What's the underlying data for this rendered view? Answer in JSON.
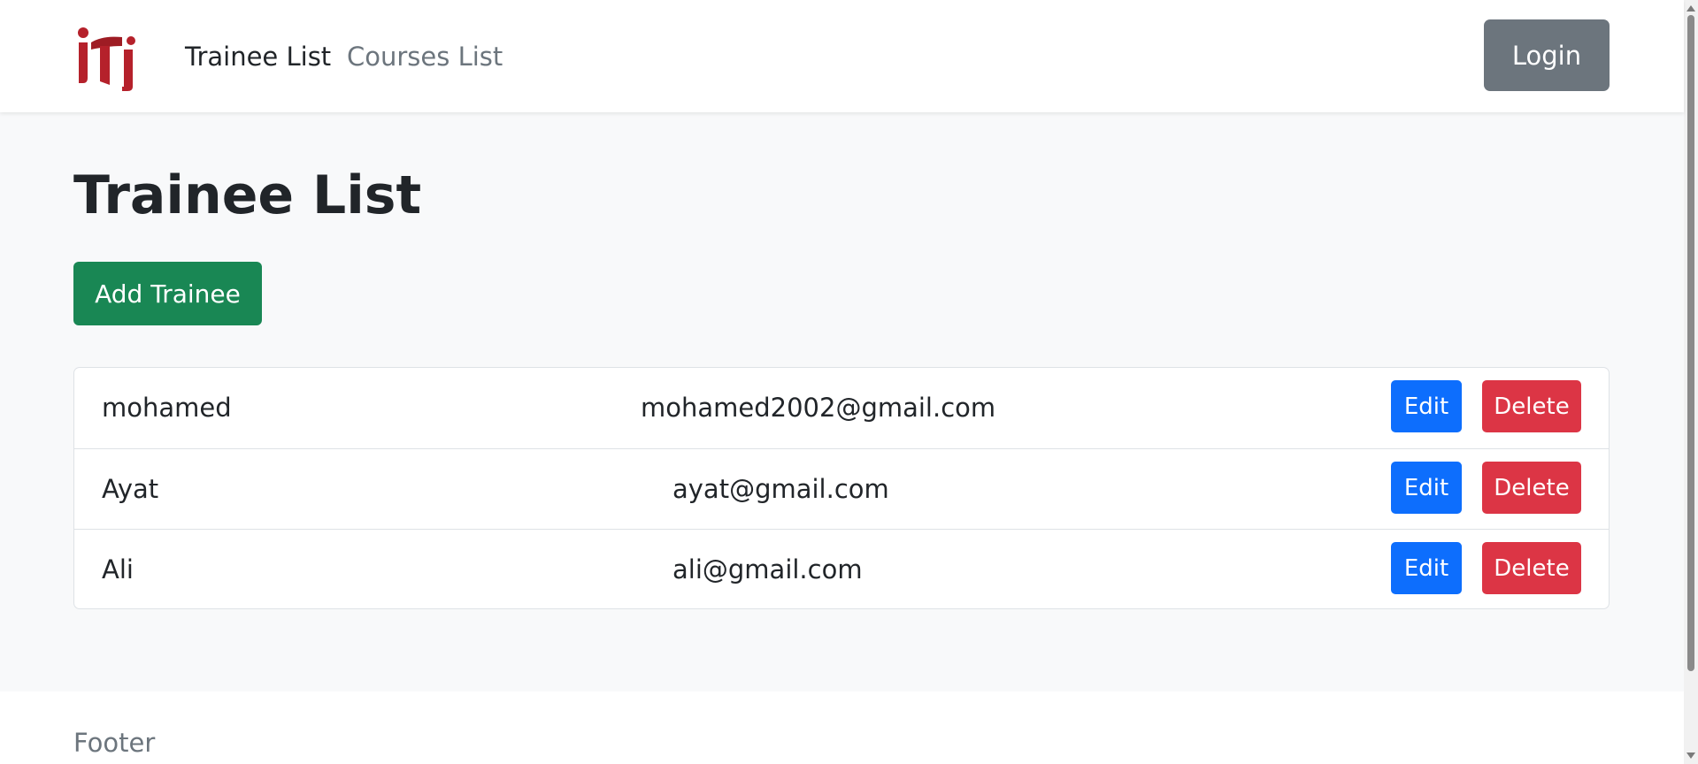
{
  "navbar": {
    "logo_icon": "iti-logo-icon",
    "links": [
      {
        "label": "Trainee List",
        "active": true
      },
      {
        "label": "Courses List",
        "active": false
      }
    ],
    "login_label": "Login"
  },
  "main": {
    "title": "Trainee List",
    "add_label": "Add Trainee",
    "trainees": [
      {
        "name": "mohamed",
        "email": "mohamed2002@gmail.com",
        "edit_label": "Edit",
        "delete_label": "Delete"
      },
      {
        "name": "Ayat",
        "email": "ayat@gmail.com",
        "edit_label": "Edit",
        "delete_label": "Delete"
      },
      {
        "name": "Ali",
        "email": "ali@gmail.com",
        "edit_label": "Edit",
        "delete_label": "Delete"
      }
    ]
  },
  "footer": {
    "text": "Footer"
  },
  "colors": {
    "primary": "#0d6efd",
    "success": "#198754",
    "danger": "#dc3545",
    "secondary": "#6c757d",
    "logo_red": "#b5212b"
  }
}
